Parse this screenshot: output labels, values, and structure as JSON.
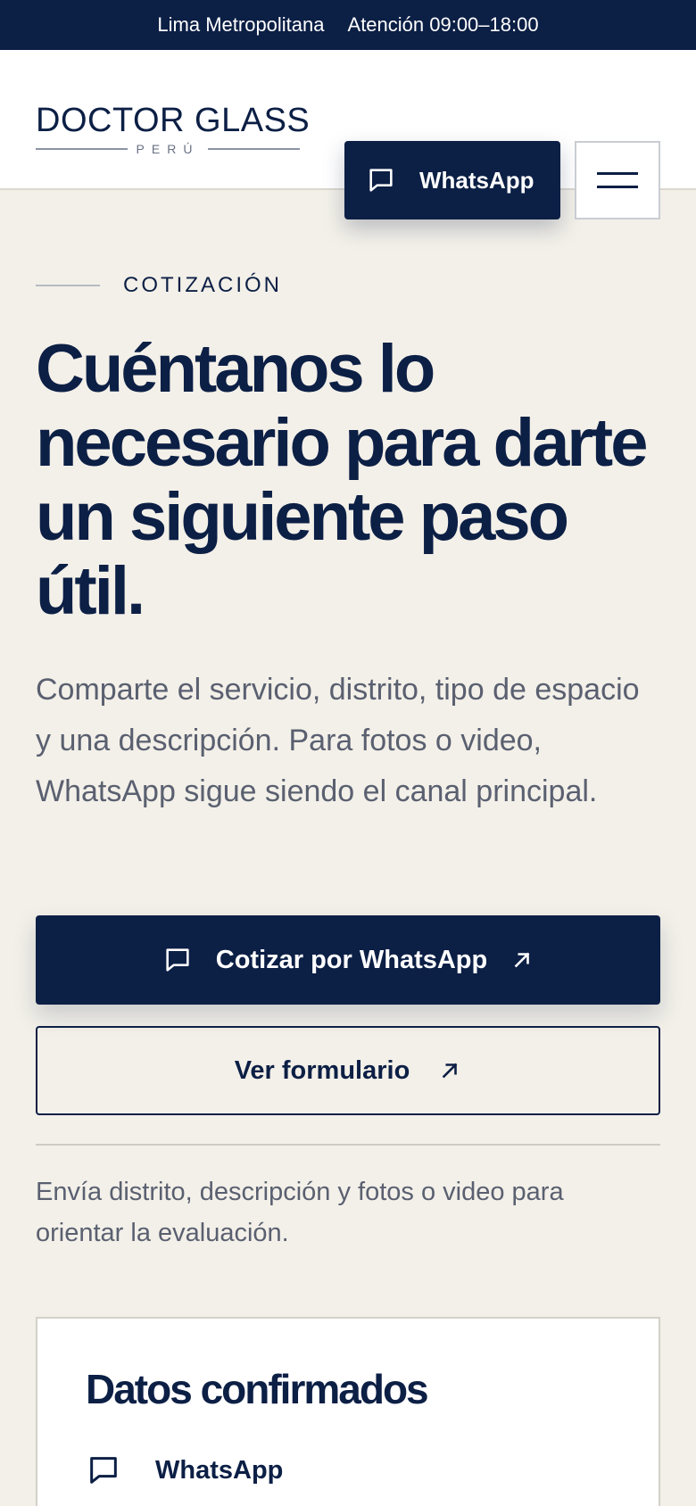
{
  "topbar": {
    "region": "Lima Metropolitana",
    "hours": "Atención 09:00–18:00"
  },
  "header": {
    "logo_main": "DOCTOR GLASS",
    "logo_sub": "PERÚ",
    "whatsapp_label": "WhatsApp"
  },
  "hero": {
    "eyebrow": "COTIZACIÓN",
    "headline": "Cuéntanos lo necesario para darte un siguiente paso útil.",
    "lead": "Comparte el servicio, distrito, tipo de espacio y una descripción. Para fotos o video, WhatsApp sigue siendo el canal principal.",
    "cta_primary": "Cotizar por WhatsApp",
    "cta_secondary": "Ver formulario",
    "note": "Envía distrito, descripción y fotos o video para orientar la evaluación."
  },
  "card": {
    "title": "Datos confirmados",
    "rows": [
      {
        "label": "WhatsApp",
        "icon": "chat-bubble-icon"
      }
    ]
  },
  "colors": {
    "navy": "#0c1f45",
    "background": "#f3f0e9",
    "muted_text": "#5a6070"
  }
}
